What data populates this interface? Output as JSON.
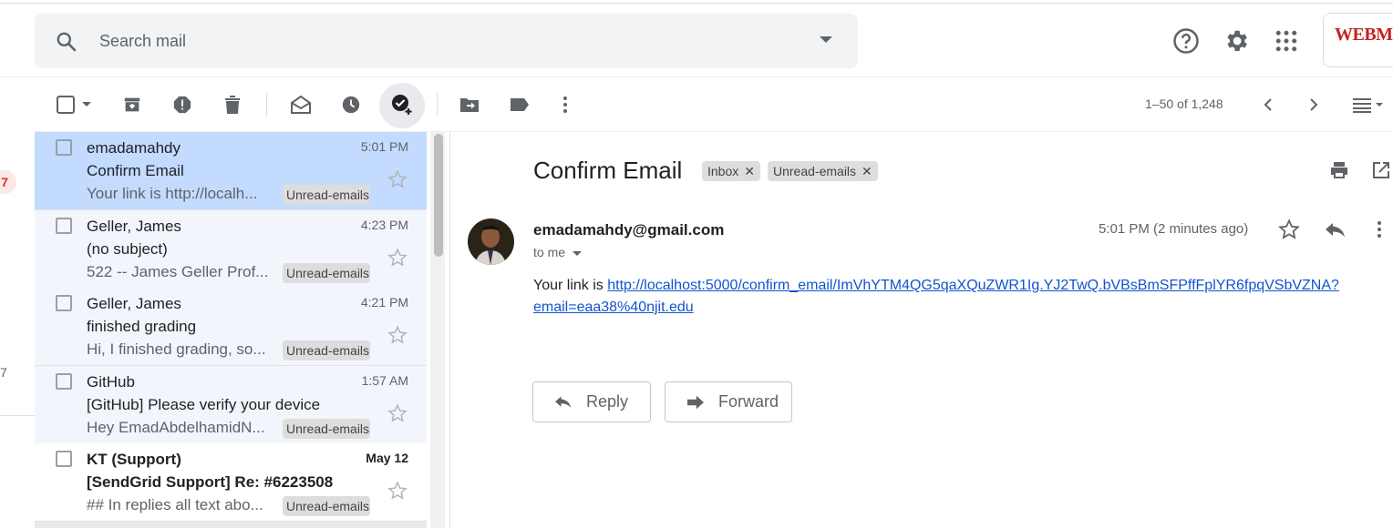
{
  "search": {
    "placeholder": "Search mail"
  },
  "brand": {
    "text": "WEBM"
  },
  "nav": {
    "badge": "7",
    "count": "7"
  },
  "toolbar": {
    "pager": "1–50 of 1,248"
  },
  "emails": [
    {
      "sender": "emadamahdy",
      "subject": "Confirm Email",
      "snippet": "Your link is http://localh...",
      "time": "5:01 PM",
      "label": "Unread-emails",
      "state": "selected"
    },
    {
      "sender": "Geller, James",
      "subject": "(no subject)",
      "snippet": "522 -- James Geller Prof...",
      "time": "4:23 PM",
      "label": "Unread-emails",
      "state": "read"
    },
    {
      "sender": "Geller, James",
      "subject": "finished grading",
      "snippet": "Hi, I finished grading, so...",
      "time": "4:21 PM",
      "label": "Unread-emails",
      "state": "read"
    },
    {
      "sender": "GitHub",
      "subject": "[GitHub] Please verify your device",
      "snippet": "Hey EmadAbdelhamidN...",
      "time": "1:57 AM",
      "label": "Unread-emails",
      "state": "read"
    },
    {
      "sender": "KT (Support)",
      "subject": "[SendGrid Support] Re: #6223508",
      "snippet": "## In replies all text abo...",
      "time": "May 12",
      "label": "Unread-emails",
      "state": "unread"
    }
  ],
  "message": {
    "subject": "Confirm Email",
    "chips": [
      "Inbox",
      "Unread-emails"
    ],
    "from": "emadamahdy@gmail.com",
    "to": "to me",
    "time": "5:01 PM (2 minutes ago)",
    "body_prefix": "Your link is ",
    "link": "http://localhost:5000/confirm_email/ImVhYTM4QG5qaXQuZWR1Ig.YJ2TwQ.bVBsBmSFPffFplYR6fpqVSbVZNA?email=eaa38%40njit.edu"
  },
  "actions": {
    "reply": "Reply",
    "forward": "Forward"
  },
  "colors": {
    "selected_row": "#c2dbff",
    "read_row": "#f2f6fc",
    "link": "#1155cc",
    "label_bg": "#dddddd"
  }
}
